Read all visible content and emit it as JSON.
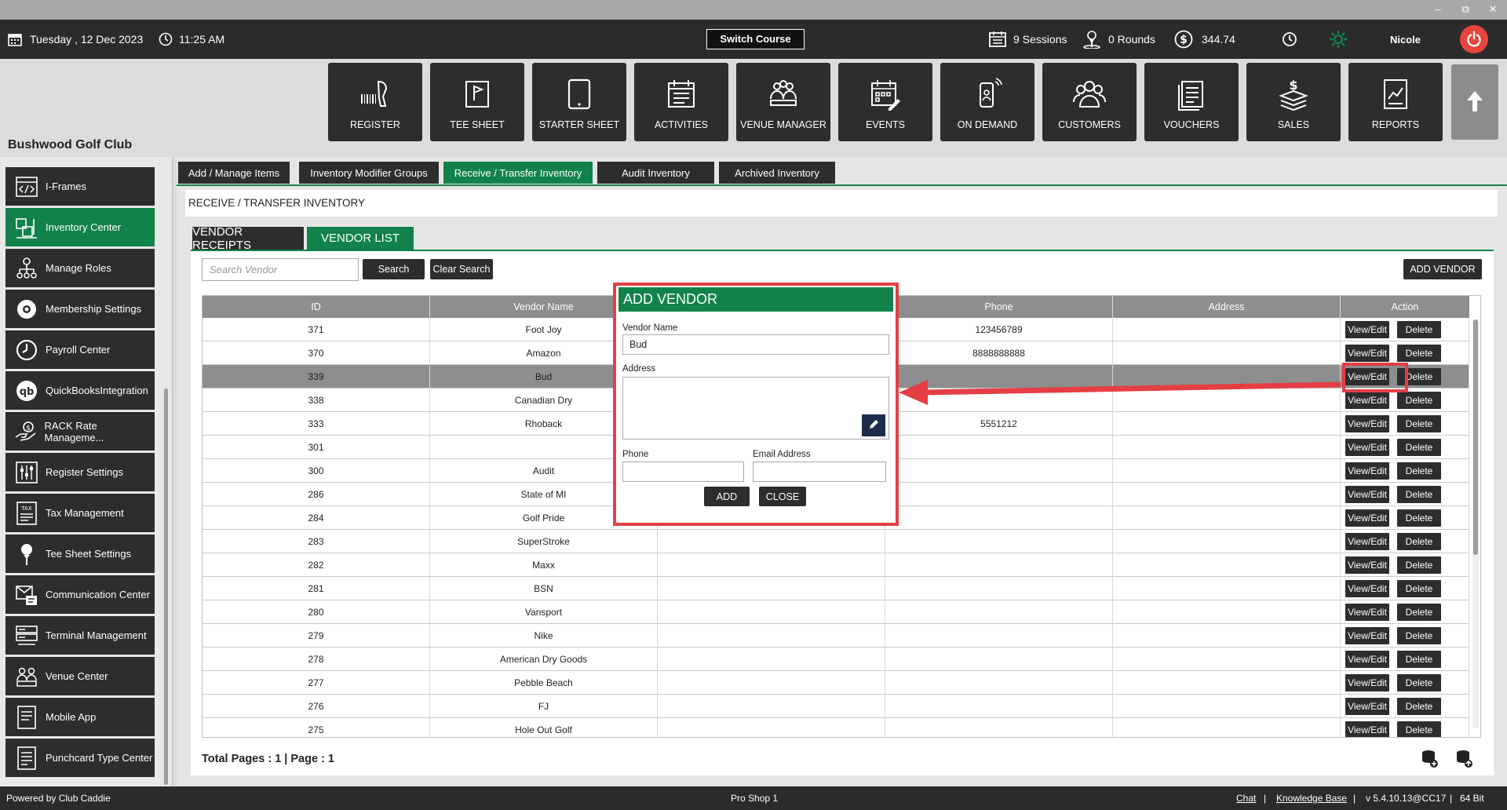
{
  "window": {
    "minimize": "–",
    "restore": "⧉",
    "close": "✕"
  },
  "topbar": {
    "date": "Tuesday ,  12 Dec 2023",
    "time": "11:25 AM",
    "switch_course": "Switch Course",
    "sessions": "9 Sessions",
    "rounds": "0 Rounds",
    "amount": "344.74",
    "user": "Nicole"
  },
  "club_name": "Bushwood Golf Club",
  "nav": [
    {
      "label": "REGISTER",
      "icon": "barcode-scanner-icon"
    },
    {
      "label": "TEE SHEET",
      "icon": "flag-icon"
    },
    {
      "label": "STARTER SHEET",
      "icon": "tablet-icon"
    },
    {
      "label": "ACTIVITIES",
      "icon": "calendar-list-icon"
    },
    {
      "label": "VENUE MANAGER",
      "icon": "venue-people-icon"
    },
    {
      "label": "EVENTS",
      "icon": "calendar-edit-icon"
    },
    {
      "label": "ON DEMAND",
      "icon": "phone-signal-icon"
    },
    {
      "label": "CUSTOMERS",
      "icon": "customers-icon"
    },
    {
      "label": "VOUCHERS",
      "icon": "vouchers-icon"
    },
    {
      "label": "SALES",
      "icon": "sales-icon"
    },
    {
      "label": "REPORTS",
      "icon": "reports-icon"
    }
  ],
  "sidebar": [
    {
      "label": "I-Frames"
    },
    {
      "label": "Inventory Center"
    },
    {
      "label": "Manage Roles"
    },
    {
      "label": "Membership Settings"
    },
    {
      "label": "Payroll Center"
    },
    {
      "label": "QuickBooksIntegration"
    },
    {
      "label": "RACK Rate Manageme..."
    },
    {
      "label": "Register Settings"
    },
    {
      "label": "Tax Management"
    },
    {
      "label": "Tee Sheet Settings"
    },
    {
      "label": "Communication Center"
    },
    {
      "label": "Terminal Management"
    },
    {
      "label": "Venue Center"
    },
    {
      "label": "Mobile App"
    },
    {
      "label": "Punchcard Type Center"
    }
  ],
  "tabs": [
    "Add / Manage Items",
    "Inventory Modifier Groups",
    "Receive / Transfer Inventory",
    "Audit Inventory",
    "Archived Inventory"
  ],
  "page_heading": "RECEIVE / TRANSFER INVENTORY",
  "subtabs": [
    "VENDOR RECEIPTS",
    "VENDOR LIST"
  ],
  "search": {
    "placeholder": "Search Vendor",
    "search_btn": "Search",
    "clear_btn": "Clear Search",
    "add_vendor": "ADD VENDOR"
  },
  "table": {
    "headers": [
      "ID",
      "Vendor Name",
      "",
      "Phone",
      "Address",
      "Action"
    ],
    "view_label": "View/Edit",
    "delete_label": "Delete",
    "rows": [
      {
        "id": "371",
        "name": "Foot Joy",
        "phone": "123456789"
      },
      {
        "id": "370",
        "name": "Amazon",
        "phone": "8888888888"
      },
      {
        "id": "339",
        "name": "Bud",
        "phone": ""
      },
      {
        "id": "338",
        "name": "Canadian Dry",
        "phone": ""
      },
      {
        "id": "333",
        "name": "Rhoback",
        "phone": "5551212"
      },
      {
        "id": "301",
        "name": "",
        "phone": ""
      },
      {
        "id": "300",
        "name": "Audit",
        "phone": ""
      },
      {
        "id": "286",
        "name": "State of MI",
        "phone": ""
      },
      {
        "id": "284",
        "name": "Golf Pride",
        "phone": ""
      },
      {
        "id": "283",
        "name": "SuperStroke",
        "phone": ""
      },
      {
        "id": "282",
        "name": "Maxx",
        "phone": ""
      },
      {
        "id": "281",
        "name": "BSN",
        "phone": ""
      },
      {
        "id": "280",
        "name": "Vansport",
        "phone": ""
      },
      {
        "id": "279",
        "name": "Nike",
        "phone": ""
      },
      {
        "id": "278",
        "name": "American Dry Goods",
        "phone": ""
      },
      {
        "id": "277",
        "name": "Pebble Beach",
        "phone": ""
      },
      {
        "id": "276",
        "name": "FJ",
        "phone": ""
      },
      {
        "id": "275",
        "name": "Hole Out Golf",
        "phone": ""
      }
    ]
  },
  "pager": "Total Pages : 1 | Page : 1",
  "modal": {
    "title": "ADD VENDOR",
    "vendor_name_label": "Vendor Name",
    "vendor_name_value": "Bud",
    "address_label": "Address",
    "phone_label": "Phone",
    "email_label": "Email Address",
    "add_btn": "ADD",
    "close_btn": "CLOSE"
  },
  "footer": {
    "powered": "Powered by Club Caddie",
    "station": "Pro Shop 1",
    "chat": "Chat",
    "sep": "|",
    "kb": "Knowledge Base",
    "version": "v 5.4.10.13@CC17",
    "bits": "64 Bit"
  },
  "colors": {
    "green": "#11834a",
    "dark": "#2d2d2d",
    "red": "#e53e44"
  }
}
